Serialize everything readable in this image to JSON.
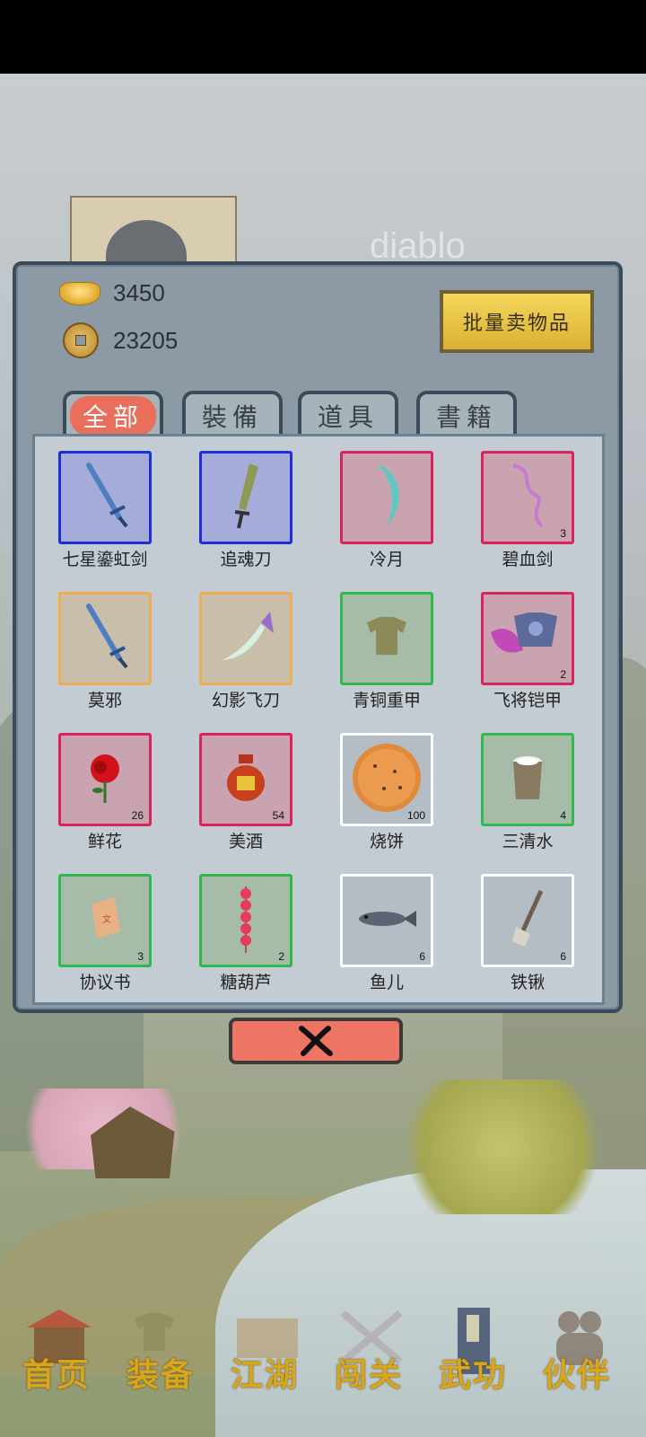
{
  "player": {
    "name": "diablo"
  },
  "wallet": {
    "gold": "3450",
    "coins": "23205"
  },
  "batch_sell_label": "批量卖物品",
  "tabs": [
    {
      "label": "全部",
      "active": true
    },
    {
      "label": "裝備",
      "active": false
    },
    {
      "label": "道具",
      "active": false
    },
    {
      "label": "書籍",
      "active": false
    }
  ],
  "items": [
    {
      "name": "七星鎏虹剑",
      "count": "",
      "rarity": "blue",
      "icon": "sword-icon"
    },
    {
      "name": "追魂刀",
      "count": "",
      "rarity": "blue",
      "icon": "broadsword-icon"
    },
    {
      "name": "冷月",
      "count": "",
      "rarity": "red",
      "icon": "crescent-blade-icon"
    },
    {
      "name": "碧血剑",
      "count": "3",
      "rarity": "red",
      "icon": "serpent-sword-icon"
    },
    {
      "name": "莫邪",
      "count": "",
      "rarity": "orange",
      "icon": "sword-icon"
    },
    {
      "name": "幻影飞刀",
      "count": "",
      "rarity": "orange",
      "icon": "flying-knife-icon"
    },
    {
      "name": "青铜重甲",
      "count": "",
      "rarity": "green",
      "icon": "armor-icon"
    },
    {
      "name": "飞将铠甲",
      "count": "2",
      "rarity": "red",
      "icon": "winged-armor-icon"
    },
    {
      "name": "鲜花",
      "count": "26",
      "rarity": "red",
      "icon": "rose-icon"
    },
    {
      "name": "美酒",
      "count": "54",
      "rarity": "red",
      "icon": "wine-jar-icon"
    },
    {
      "name": "烧饼",
      "count": "100",
      "rarity": "white",
      "icon": "flatbread-icon"
    },
    {
      "name": "三清水",
      "count": "4",
      "rarity": "green",
      "icon": "bucket-icon"
    },
    {
      "name": "协议书",
      "count": "3",
      "rarity": "green",
      "icon": "scroll-icon"
    },
    {
      "name": "糖葫芦",
      "count": "2",
      "rarity": "green",
      "icon": "candied-haws-icon"
    },
    {
      "name": "鱼儿",
      "count": "6",
      "rarity": "white",
      "icon": "fish-icon"
    },
    {
      "name": "铁锹",
      "count": "6",
      "rarity": "white",
      "icon": "shovel-icon"
    }
  ],
  "nav": [
    {
      "label": "首页",
      "icon": "home-icon",
      "color": "#d8a61a"
    },
    {
      "label": "装备",
      "icon": "armor-icon",
      "color": "#d8a61a"
    },
    {
      "label": "江湖",
      "icon": "map-scroll-icon",
      "color": "#d8a61a"
    },
    {
      "label": "闯关",
      "icon": "crossed-swords-icon",
      "color": "#d8a61a"
    },
    {
      "label": "武功",
      "icon": "book-icon",
      "color": "#d8a61a"
    },
    {
      "label": "伙伴",
      "icon": "companions-icon",
      "color": "#d8a61a"
    }
  ],
  "colors": {
    "rarity_blue": "#1c2fd9",
    "rarity_red": "#d8245b",
    "rarity_orange": "#efad52",
    "rarity_green": "#2fb84c",
    "rarity_white": "#ffffff",
    "close_button": "#ee7563",
    "batch_button": "#f4d65a"
  }
}
